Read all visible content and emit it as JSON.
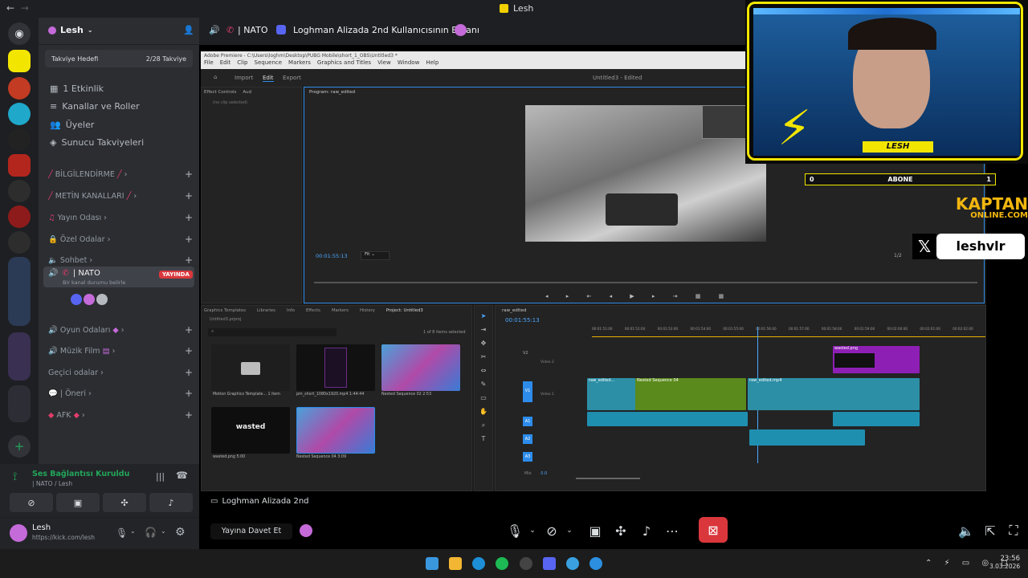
{
  "titlebar": {
    "back": "←",
    "forward": "→",
    "title": "Lesh"
  },
  "server": {
    "name": "Lesh",
    "boost": {
      "label": "Takviye Hedefi",
      "value": "2/28 Takviye"
    },
    "menu": [
      "1 Etkinlik",
      "Kanallar ve Roller",
      "Üyeler",
      "Sunucu Takviyeleri"
    ],
    "categories": [
      "BİLGİLENDİRME",
      "METİN KANALLARI",
      "Yayın Odası",
      "Özel Odalar",
      "Sohbet",
      "Oyun Odaları",
      "Müzik Film",
      "Geçici odalar",
      "| Öneri",
      "AFK"
    ],
    "voice_channel": {
      "name": "| NATO",
      "badge": "YAYINDA",
      "desc": "Bir kanal durumu belirle"
    }
  },
  "voice": {
    "status": "Ses Bağlantısı Kuruldu",
    "channel": "| NATO / Lesh"
  },
  "user": {
    "name": "Lesh",
    "status": "https://kick.com/lesh"
  },
  "stream": {
    "channel": "| NATO",
    "title": "Loghman Alizada 2nd Kullanıcısının Ekranı",
    "viewer_label": "Loghman Alizada 2nd",
    "invite": "Yayına Davet Et"
  },
  "premiere": {
    "titlebar": "Adobe Premiere - C:\\Users\\loghm\\Desktop\\PUBG Mobile\\short_1_OBS\\Untitled3 *",
    "menu": [
      "File",
      "Edit",
      "Clip",
      "Sequence",
      "Markers",
      "Graphics and Titles",
      "View",
      "Window",
      "Help"
    ],
    "tabs": [
      "Import",
      "Edit",
      "Export"
    ],
    "doc_title": "Untitled3 - Edited",
    "program_label": "Program: raw_edited",
    "effect_tabs": [
      "Effect Controls",
      "Aud"
    ],
    "no_clip": "(no clip selected)",
    "timecode": "00:01:55:13",
    "fit": "Fit",
    "ratio": "1/2",
    "project_tabs": [
      "Graphics Templates",
      "Libraries",
      "Info",
      "Effects",
      "Markers",
      "History",
      "Project: Untitled3"
    ],
    "project_file": "Untitled3.prproj",
    "selection": "1 of 8 items selected",
    "bins": [
      {
        "name": "Motion Graphics Template...",
        "meta": "1 item"
      },
      {
        "name": "pm_short_1080x1920.mp4",
        "meta": "1:44:44"
      },
      {
        "name": "Nested Sequence 02",
        "meta": "2:53"
      },
      {
        "name": "wasted.png",
        "meta": "5:00"
      },
      {
        "name": "Nested Sequence 04",
        "meta": "3:09"
      }
    ],
    "wasted_text": "wasted",
    "seq_name": "raw_edited",
    "seq_timecode": "00:01:55:13",
    "ruler": [
      "00:01:51:00",
      "00:01:52:00",
      "00:01:53:00",
      "00:01:54:00",
      "00:01:55:00",
      "00:01:56:00",
      "00:01:57:00",
      "00:01:58:00",
      "00:01:59:00",
      "00:02:00:00",
      "00:02:01:00",
      "00:02:02:00"
    ],
    "tracks": [
      "V2",
      "V1",
      "A1",
      "A2",
      "A3"
    ],
    "track_names": [
      "Video 2",
      "Video 1"
    ],
    "clips": {
      "v2": "wasted.png",
      "v1a": "raw_edited...",
      "v1b": "Nested Sequence 04",
      "v1c": "raw_edited.mp4"
    },
    "mix_label": "Mix",
    "mix_value": "0.0"
  },
  "overlay": {
    "cam_name": "LESH",
    "sub_label": "ABONE",
    "sub_current": "0",
    "sub_goal": "1",
    "brand1": "KAPTAN",
    "brand2": "ONLINE.COM",
    "handle": "leshvlr"
  },
  "taskbar": {
    "time": "23:56",
    "date": "3.03.2026"
  },
  "colors": {
    "discord_bg": "#2b2d31",
    "accent_yellow": "#f2e600",
    "live_red": "#da373c",
    "green": "#23a55a"
  }
}
